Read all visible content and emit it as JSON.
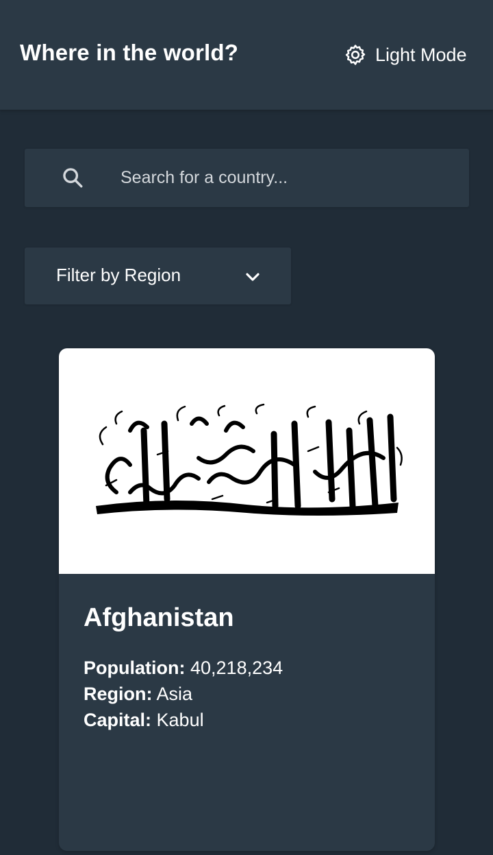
{
  "header": {
    "title": "Where in the world?",
    "mode_label": "Light Mode",
    "mode_icon": "gear-icon"
  },
  "search": {
    "placeholder": "Search for a country...",
    "value": "",
    "icon": "search-icon"
  },
  "filter": {
    "label": "Filter by Region",
    "icon": "chevron-down-icon"
  },
  "countries": [
    {
      "name": "Afghanistan",
      "population_label": "Population:",
      "population": "40,218,234",
      "region_label": "Region:",
      "region": "Asia",
      "capital_label": "Capital:",
      "capital": "Kabul"
    }
  ],
  "colors": {
    "background": "#202c37",
    "elements": "#2b3945",
    "text": "#ffffff",
    "placeholder": "#d4d8dc",
    "flag_bg": "#ffffff"
  }
}
